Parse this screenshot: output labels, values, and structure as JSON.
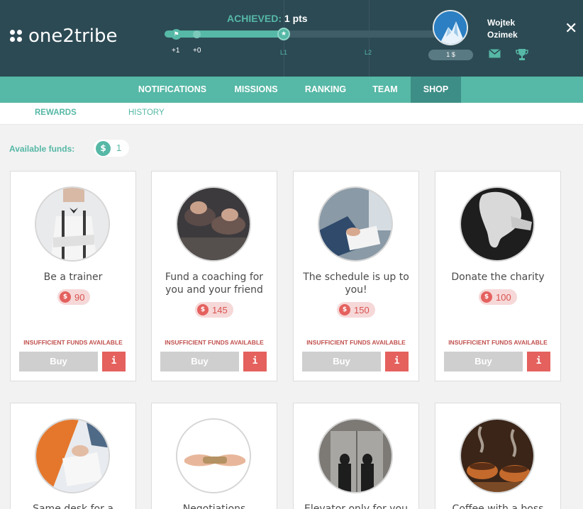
{
  "header": {
    "logo_text": "one2tribe",
    "achieved_label": "ACHIEVED:",
    "achieved_points": "1 pts",
    "progress": {
      "markers": [
        "+1",
        "+0"
      ],
      "levels": [
        "L1",
        "L2"
      ]
    },
    "user": {
      "first_name": "Wojtek",
      "last_name": "Ozimek",
      "balance": "1 $"
    },
    "close_label": "✕"
  },
  "nav": {
    "items": [
      {
        "label": "NOTIFICATIONS"
      },
      {
        "label": "MISSIONS"
      },
      {
        "label": "RANKING"
      },
      {
        "label": "TEAM"
      },
      {
        "label": "SHOP"
      }
    ],
    "active": "SHOP"
  },
  "subnav": {
    "items": [
      {
        "label": "REWARDS"
      },
      {
        "label": "HISTORY"
      }
    ]
  },
  "funds": {
    "label": "Available funds:",
    "currency_symbol": "$",
    "value": "1"
  },
  "rewards": [
    {
      "title": "Be a trainer",
      "currency": "$",
      "price": "90",
      "status": "INSUFFICIENT FUNDS AVAILABLE",
      "buy_label": "Buy",
      "info_label": "i"
    },
    {
      "title": "Fund a coaching for you and your friend",
      "currency": "$",
      "price": "145",
      "status": "INSUFFICIENT FUNDS AVAILABLE",
      "buy_label": "Buy",
      "info_label": "i"
    },
    {
      "title": "The schedule is up to you!",
      "currency": "$",
      "price": "150",
      "status": "INSUFFICIENT FUNDS AVAILABLE",
      "buy_label": "Buy",
      "info_label": "i"
    },
    {
      "title": "Donate the charity",
      "currency": "$",
      "price": "100",
      "status": "INSUFFICIENT FUNDS AVAILABLE",
      "buy_label": "Buy",
      "info_label": "i"
    },
    {
      "title": "Same desk for a"
    },
    {
      "title": "Negotiations"
    },
    {
      "title": "Elevator only for you"
    },
    {
      "title": "Coffee with a boss"
    }
  ],
  "colors": {
    "header_bg": "#2c4a54",
    "accent": "#56b8a6",
    "nav_active": "#3d8e86",
    "danger": "#e4615e"
  }
}
